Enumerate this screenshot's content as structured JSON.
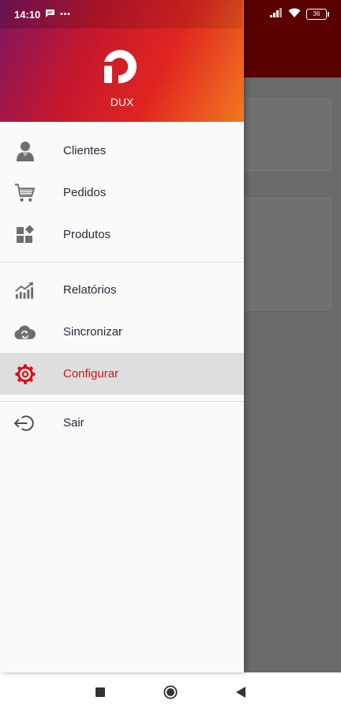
{
  "status_bar": {
    "time": "14:10",
    "dots": "•••",
    "battery": "36"
  },
  "drawer": {
    "brand": "DUX",
    "items": [
      {
        "label": "Clientes",
        "icon": "person-icon"
      },
      {
        "label": "Pedidos",
        "icon": "shopping-cart-icon"
      },
      {
        "label": "Produtos",
        "icon": "widgets-icon"
      },
      {
        "label": "Relatórios",
        "icon": "trending-up-chart-icon"
      },
      {
        "label": "Sincronizar",
        "icon": "cloud-sync-icon"
      },
      {
        "label": "Configurar",
        "icon": "gear-icon",
        "active": true
      },
      {
        "label": "Sair",
        "icon": "exit-icon"
      }
    ]
  },
  "colors": {
    "accent": "#d5121c",
    "header_gradient_start": "#7d1561",
    "header_gradient_end": "#f07a20"
  }
}
